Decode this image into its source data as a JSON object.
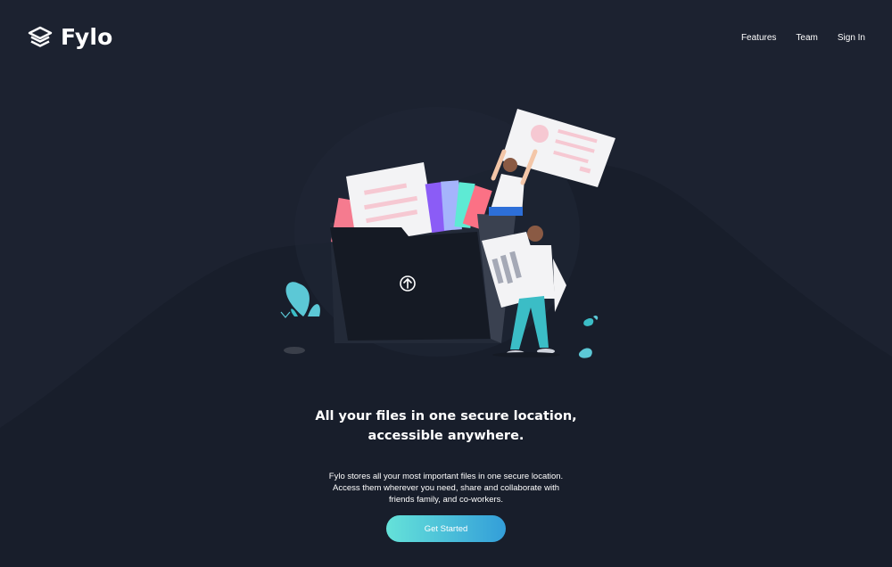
{
  "brand": {
    "name": "Fylo",
    "icon": "layers-icon"
  },
  "nav": {
    "items": [
      {
        "label": "Features"
      },
      {
        "label": "Team"
      },
      {
        "label": "Sign In"
      }
    ]
  },
  "hero": {
    "title_line1": "All your files in one secure location,",
    "title_line2": "accessible anywhere.",
    "description": "Fylo stores all your most important files in one secure location. Access them wherever you need, share and collaborate with friends family, and co-workers.",
    "cta_label": "Get Started",
    "illustration_icon": "upload-arrow-icon"
  },
  "colors": {
    "background": "#1c2230",
    "wave": "#181e2b",
    "cta_gradient_start": "#65e2d9",
    "cta_gradient_end": "#339ed9"
  }
}
